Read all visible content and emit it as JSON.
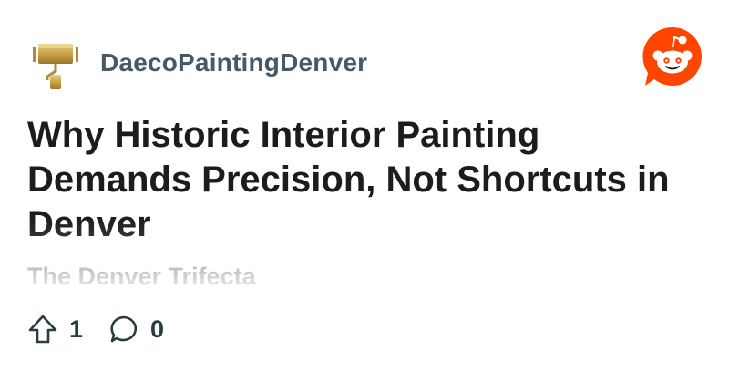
{
  "post": {
    "author": "DaecoPaintingDenver",
    "title": "Why Historic Interior Painting Demands Precision, Not Shortcuts in Denver",
    "subreddit": "The Denver Trifecta",
    "upvotes": "1",
    "comments": "0"
  },
  "icons": {
    "avatar": "paint-roller-logo",
    "brand": "reddit-snoo-logo",
    "upvote": "upvote-arrow-icon",
    "comment": "comment-bubble-icon"
  },
  "colors": {
    "reddit_orange": "#ff4500",
    "avatar_gold": "#c9a24a",
    "author_text": "#465a65",
    "title_text": "#1c1c1c"
  }
}
